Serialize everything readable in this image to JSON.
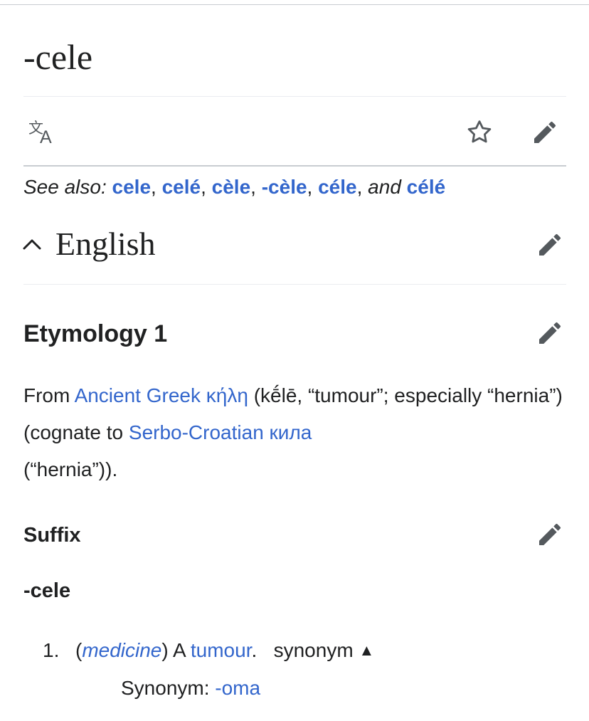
{
  "page": {
    "title": "-cele"
  },
  "toolbar": {
    "language_icon": "translate-icon",
    "watch_icon": "star-icon",
    "edit_icon": "pencil-icon"
  },
  "see_also": {
    "prefix": "See also:",
    "links": [
      "cele",
      "celé",
      "cèle",
      "-cèle",
      "céle",
      "célé"
    ],
    "sep": ",",
    "and": "and"
  },
  "section": {
    "toggle_icon": "chevron-up-icon",
    "heading": "English",
    "edit_icon": "pencil-icon"
  },
  "etymology": {
    "heading": "Etymology 1",
    "text_from": "From",
    "link_language": "Ancient Greek",
    "link_word": "κήλη",
    "text_gloss": "(kḗlē, “tumour”; especially “hernia”) (cognate to",
    "link_cognate_lang": "Serbo-Croatian",
    "link_cognate_word": "кила",
    "text_end": "(“hernia”))."
  },
  "suffix": {
    "heading": "Suffix",
    "headword": "-cele"
  },
  "definition": {
    "number": "1.",
    "open_paren": "(",
    "label": "medicine",
    "close_paren": ")",
    "text_a": "A",
    "link": "tumour",
    "period": ".",
    "synonym_toggle": "synonym",
    "synonym_toggle_icon": "▲",
    "synonym_label": "Synonym:",
    "synonym_link": "-oma"
  },
  "colors": {
    "link": "#3366cc",
    "text": "#202122",
    "icon": "#54595d",
    "divider": "#c8ccd1"
  }
}
